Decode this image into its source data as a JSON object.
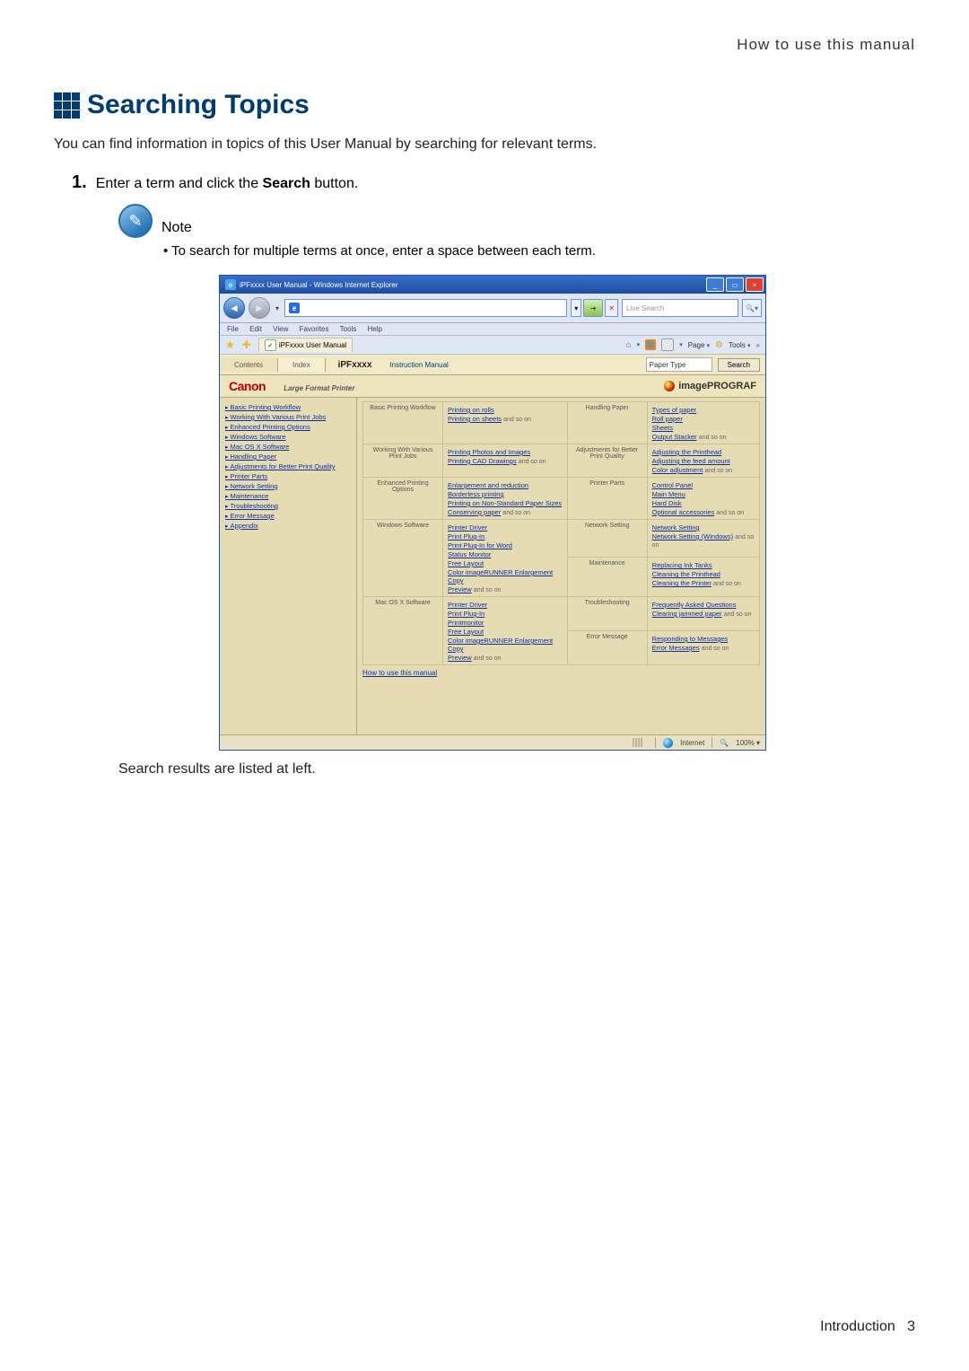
{
  "page": {
    "top_label": "How to use this manual",
    "heading": "Searching Topics",
    "intro": "You can find information in topics of this User Manual by searching for relevant terms.",
    "step1_num": "1.",
    "step1_pre": "Enter a term and click the ",
    "step1_bold": "Search",
    "step1_post": " button.",
    "note_label": "Note",
    "note_bullet": "To search for multiple terms at once, enter a space between each term.",
    "result_line": "Search results are listed at left.",
    "footer_left": "Introduction",
    "footer_page": "3"
  },
  "browser": {
    "title": "iPFxxxx User Manual - Windows Internet Explorer",
    "live_search": "Live Search",
    "menus": [
      "File",
      "Edit",
      "View",
      "Favorites",
      "Tools",
      "Help"
    ],
    "tab_label": "iPFxxxx User Manual",
    "tool_page": "Page",
    "tool_tools": "Tools",
    "status_internet": "Internet",
    "status_zoom": "100%"
  },
  "inner": {
    "tab_contents": "Contents",
    "tab_index": "Index",
    "product": "iPFxxxx",
    "instruction": "Instruction Manual",
    "search_value": "Paper Type",
    "search_btn": "Search",
    "brand": "Canon",
    "lfp": "Large Format Printer",
    "ipg": "imagePROGRAF",
    "howto": "How to use this manual",
    "andso": "and so on"
  },
  "left_tree": [
    "Basic Printing Workflow",
    "Working With Various Print Jobs",
    "Enhanced Printing Options",
    "Windows Software",
    "Mac OS X Software",
    "Handling Paper",
    "Adjustments for Better Print Quality",
    "Printer Parts",
    "Network Setting",
    "Maintenance",
    "Troubleshooting",
    "Error Message",
    "Appendix"
  ],
  "grid": [
    {
      "head": "Basic Printing Workflow",
      "links": [
        "Printing on rolls",
        "Printing on sheets"
      ],
      "tail": true
    },
    {
      "head": "Handling Paper",
      "links": [
        "Types of paper",
        "Roll paper",
        "Sheets",
        "Output Stacker"
      ],
      "tail": true
    },
    {
      "head": "Working With Various Print Jobs",
      "links": [
        "Printing Photos and Images",
        "Printing CAD Drawings"
      ],
      "tail": true
    },
    {
      "head": "Adjustments for Better Print Quality",
      "links": [
        "Adjusting the Printhead",
        "Adjusting the feed amount",
        "Color adjustment"
      ],
      "tail": true
    },
    {
      "head": "Enhanced Printing Options",
      "links": [
        "Enlargement and reduction",
        "Borderless printing",
        "Printing on Non-Standard Paper Sizes",
        "Conserving paper"
      ],
      "tail": true
    },
    {
      "head": "Printer Parts",
      "links": [
        "Control Panel",
        "Main Menu",
        "Hard Disk",
        "Optional accessories"
      ],
      "tail": true
    },
    {
      "head": "Windows Software",
      "links": [
        "Printer Driver",
        "Print Plug-In",
        "Print Plug-In for Word",
        "Status Monitor",
        "Free Layout",
        "Color imageRUNNER Enlargement Copy",
        "Preview"
      ],
      "tail": true
    },
    {
      "head": "Network Setting",
      "links": [
        "Network Setting",
        "Network Setting (Windows)"
      ],
      "tail": true
    },
    {
      "head2": "Maintenance",
      "links2": [
        "Replacing Ink Tanks",
        "Cleaning the Printhead",
        "Cleaning the Printer"
      ],
      "tail2": true
    },
    {
      "head": "Mac OS X Software",
      "links": [
        "Printer Driver",
        "Print Plug-In",
        "Printmonitor",
        "Free Layout",
        "Color imageRUNNER Enlargement Copy",
        "Preview"
      ],
      "tail": true
    },
    {
      "head": "Troubleshooting",
      "links": [
        "Frequently Asked Questions",
        "Clearing jammed paper"
      ],
      "tail": true
    },
    {
      "head2": "Error Message",
      "links2": [
        "Responding to Messages",
        "Error Messages"
      ],
      "tail2": true
    }
  ]
}
